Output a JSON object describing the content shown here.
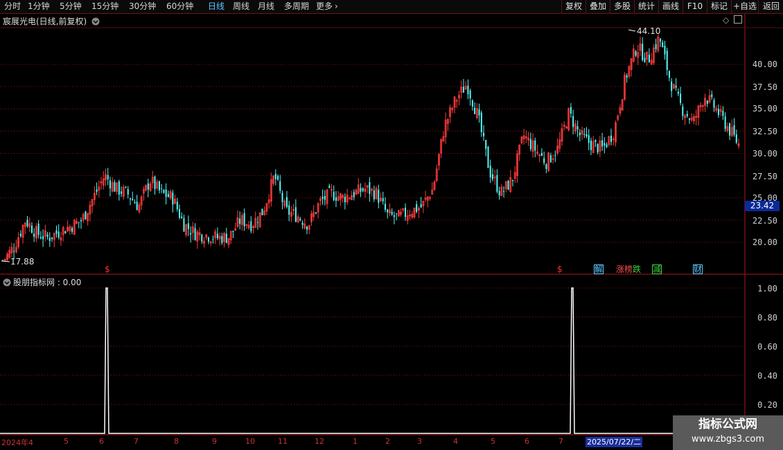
{
  "toolbar": {
    "periods": [
      "分时",
      "1分钟",
      "5分钟",
      "15分钟",
      "30分钟",
      "60分钟",
      "日线",
      "周线",
      "月线",
      "多周期",
      "更多"
    ],
    "active_period": "日线",
    "more_arrow": "›",
    "right_buttons": [
      "复权",
      "叠加",
      "多股",
      "统计",
      "画线",
      "F10",
      "标记",
      "+自选",
      "返回"
    ]
  },
  "main_chart": {
    "title": "宸展光电(日线,前复权)",
    "dropdown_icon": "chevron-down-icon",
    "high_label": "44.10",
    "low_label": "17.88",
    "current_price": "23.42",
    "price_axis": [
      "40.00",
      "37.50",
      "35.00",
      "32.50",
      "30.00",
      "27.50",
      "25.00",
      "22.50",
      "20.00"
    ],
    "markers": [
      {
        "text": "$",
        "color": "#ff3030"
      },
      {
        "text": "$",
        "color": "#ff3030"
      },
      {
        "text": "解",
        "color": "#5ec8ff"
      },
      {
        "text": "涨榜",
        "color": "#ff5050"
      },
      {
        "text": "跌",
        "color": "#40d040"
      },
      {
        "text": "减",
        "color": "#40d040"
      },
      {
        "text": "财",
        "color": "#5ec8ff"
      }
    ]
  },
  "indicator": {
    "title": "股朋指标网 : 0.00",
    "axis": [
      "1.00",
      "0.80",
      "0.60",
      "0.40",
      "0.20"
    ]
  },
  "date_axis": [
    "2024年4",
    "5",
    "6",
    "7",
    "8",
    "9",
    "10",
    "11",
    "12",
    "1",
    "2",
    "3",
    "4",
    "5",
    "6",
    "7"
  ],
  "selected_date": "2025/07/22/二",
  "watermark": {
    "line1": "指标公式网",
    "line2": "www.zbgs3.com"
  },
  "colors": {
    "up": "#ff3c3c",
    "down": "#54fcfc",
    "grid": "#8a1414",
    "axis_border": "#b01818",
    "signal": "#ffffff"
  },
  "chart_data": [
    {
      "type": "candlestick",
      "title": "宸展光电(日线,前复权)",
      "ylim": [
        17.5,
        44.5
      ],
      "y_ticks": [
        20.0,
        22.5,
        25.0,
        27.5,
        30.0,
        32.5,
        35.0,
        37.5,
        40.0
      ],
      "x_ticks": [
        "2024年4",
        "5",
        "6",
        "7",
        "8",
        "9",
        "10",
        "11",
        "12",
        "1",
        "2",
        "3",
        "4",
        "5",
        "6",
        "7"
      ],
      "approx_close_path": [
        17.9,
        19.5,
        22.5,
        21.0,
        20.5,
        21.2,
        21.8,
        22.5,
        25.0,
        27.5,
        26.0,
        25.5,
        24.0,
        27.0,
        25.5,
        25.0,
        22.0,
        21.0,
        20.8,
        20.5,
        20.6,
        22.5,
        22.0,
        23.5,
        27.5,
        23.5,
        23.0,
        22.0,
        24.5,
        25.5,
        25.0,
        25.5,
        26.0,
        25.5,
        23.0,
        22.8,
        23.5,
        24.0,
        26.0,
        33.0,
        36.0,
        37.8,
        34.0,
        28.0,
        25.5,
        27.0,
        32.0,
        30.5,
        29.0,
        30.5,
        34.5,
        32.0,
        31.0,
        30.5,
        32.5,
        38.5,
        42.0,
        40.5,
        43.0,
        38.0,
        35.0,
        33.5,
        36.5,
        35.0,
        33.0,
        31.0
      ],
      "high": 44.1,
      "low": 17.88,
      "last": 23.42
    },
    {
      "type": "line",
      "title": "股朋指标网 : 0.00",
      "ylim": [
        0,
        1.05
      ],
      "y_ticks": [
        0.2,
        0.4,
        0.6,
        0.8,
        1.0
      ],
      "signal_points": [
        {
          "x": "2024年6",
          "y": 1.0
        },
        {
          "x": "2025年7",
          "y": 1.0
        }
      ],
      "baseline": 0.0
    }
  ]
}
